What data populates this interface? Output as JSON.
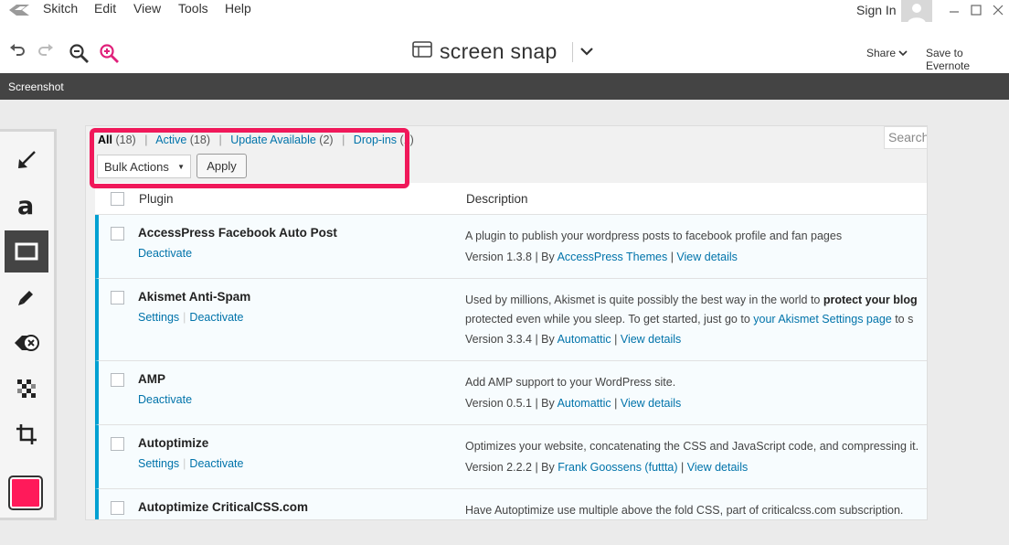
{
  "menubar": {
    "items": [
      "Skitch",
      "Edit",
      "View",
      "Tools",
      "Help"
    ],
    "sign_in": "Sign In"
  },
  "toolbar": {
    "doc_title": "screen snap",
    "share": "Share",
    "save_to_evernote": "Save to Evernote"
  },
  "tabbar": {
    "tab": "Screenshot"
  },
  "colors": {
    "accent": "#ff1a5a",
    "link": "#0073aa",
    "active_border": "#00a0d2",
    "highlight": "#f0185a"
  },
  "canvas": {
    "filters": {
      "all_label": "All",
      "all_count": "(18)",
      "active_label": "Active",
      "active_count": "(18)",
      "update_label": "Update Available",
      "update_count": "(2)",
      "dropins_label": "Drop-ins",
      "dropins_count": "(1)",
      "separator": "|"
    },
    "bulk_actions": "Bulk Actions",
    "apply": "Apply",
    "search_placeholder": "Search",
    "table": {
      "headers": {
        "plugin": "Plugin",
        "description": "Description"
      },
      "rows": [
        {
          "name": "AccessPress Facebook Auto Post",
          "actions": [
            "Deactivate"
          ],
          "description": "A plugin to publish your wordpress posts to facebook profile and fan pages",
          "version": "Version 1.3.8",
          "by": "By",
          "author": "AccessPress Themes",
          "view_details": "View details"
        },
        {
          "name": "Akismet Anti-Spam",
          "actions": [
            "Settings",
            "Deactivate"
          ],
          "description_part1": "Used by millions, Akismet is quite possibly the best way in the world to ",
          "description_bold": "protect your blog",
          "description_line2_part1": "protected even while you sleep. To get started, just go to ",
          "description_link": "your Akismet Settings page",
          "description_line2_part2": " to s",
          "version": "Version 3.3.4",
          "by": "By",
          "author": "Automattic",
          "view_details": "View details"
        },
        {
          "name": "AMP",
          "actions": [
            "Deactivate"
          ],
          "description": "Add AMP support to your WordPress site.",
          "version": "Version 0.5.1",
          "by": "By",
          "author": "Automattic",
          "view_details": "View details"
        },
        {
          "name": "Autoptimize",
          "actions": [
            "Settings",
            "Deactivate"
          ],
          "description": "Optimizes your website, concatenating the CSS and JavaScript code, and compressing it.",
          "version": "Version 2.2.2",
          "by": "By",
          "author": "Frank Goossens (futtta)",
          "view_details": "View details"
        },
        {
          "name": "Autoptimize CriticalCSS.com",
          "description": "Have Autoptimize use multiple above the fold CSS, part of criticalcss.com subscription."
        }
      ]
    }
  },
  "icons": {
    "logo": "skitch-logo-icon",
    "undo": "undo-icon",
    "redo": "redo-icon",
    "zoom_out": "zoom-out-icon",
    "zoom_in": "zoom-in-icon",
    "tools": [
      "arrow-tool-icon",
      "text-tool-icon",
      "rectangle-tool-icon",
      "highlighter-tool-icon",
      "stamp-tool-icon",
      "pixelate-tool-icon",
      "crop-tool-icon"
    ]
  }
}
